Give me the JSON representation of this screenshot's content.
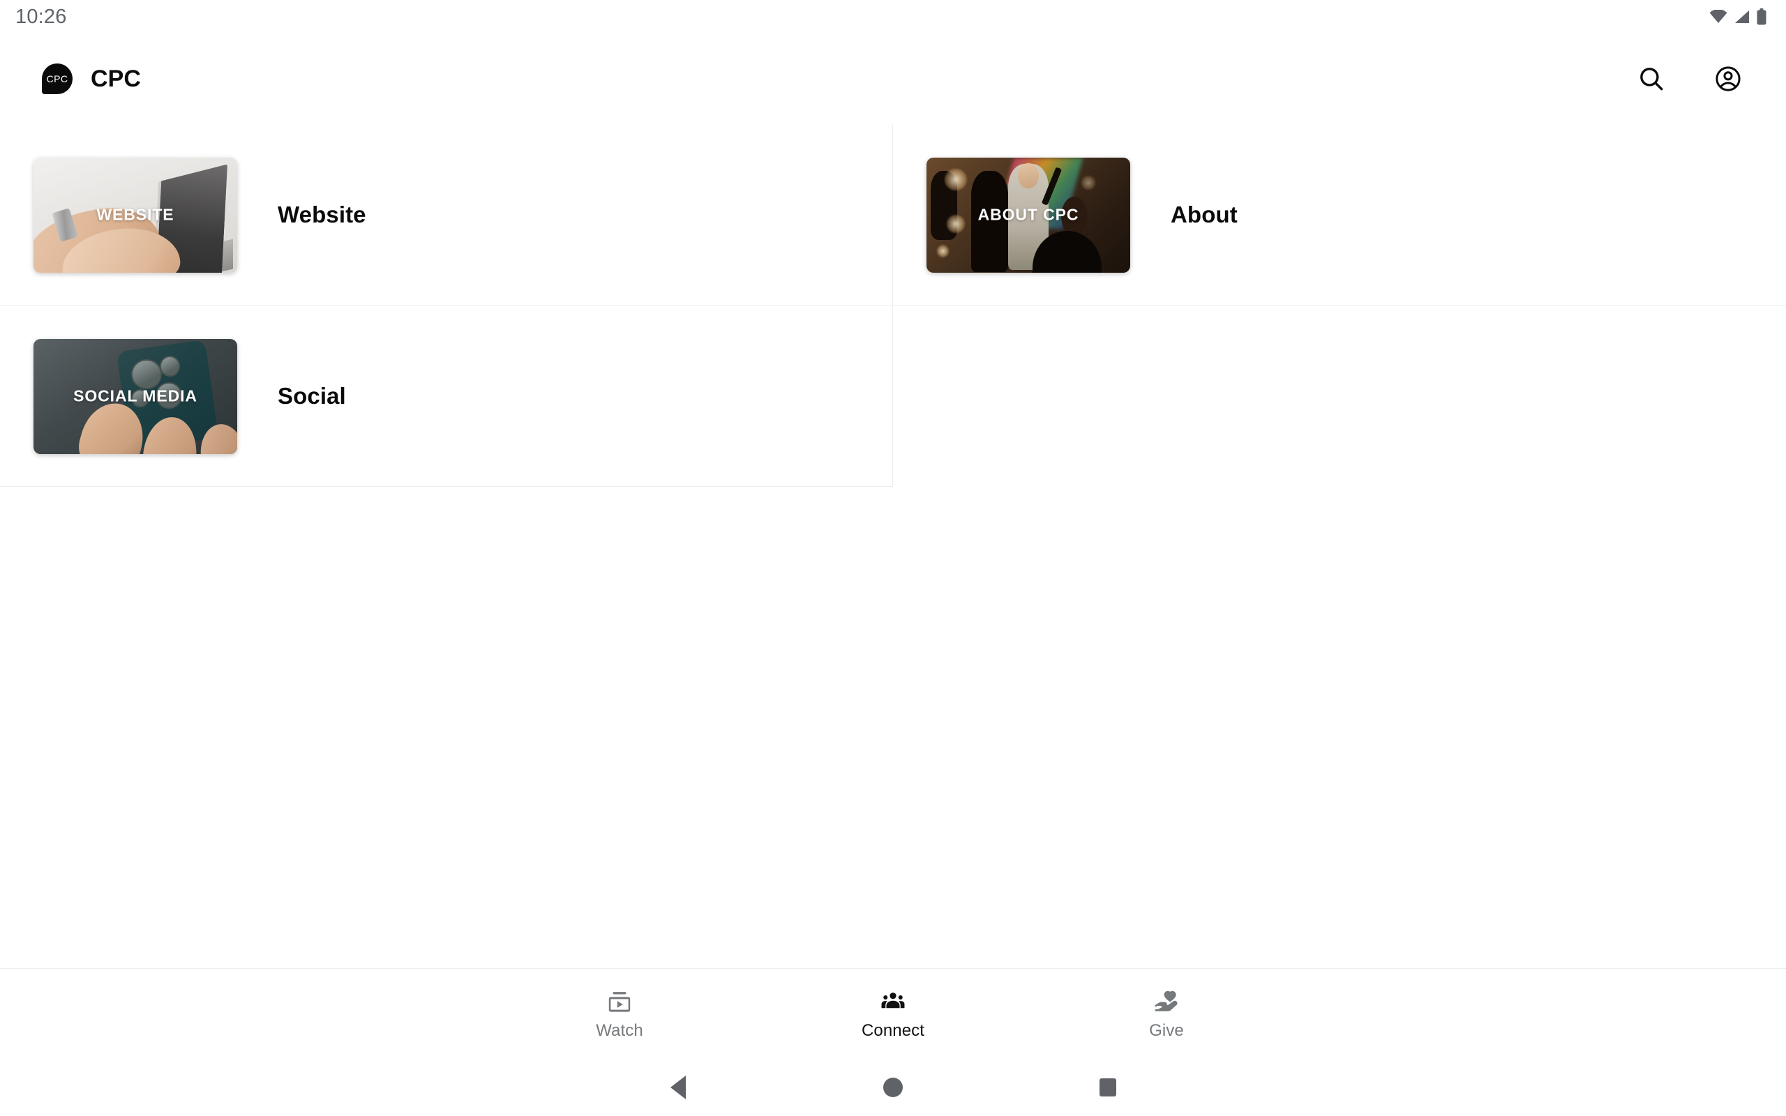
{
  "status_bar": {
    "time": "10:26",
    "icons": [
      "wifi-icon",
      "cellular-signal-icon",
      "battery-icon"
    ]
  },
  "app_bar": {
    "logo_text": "CPC",
    "title": "CPC",
    "actions": [
      {
        "name": "search-icon",
        "label": "Search"
      },
      {
        "name": "account-icon",
        "label": "Account"
      }
    ]
  },
  "main": {
    "items": [
      {
        "title": "Website",
        "thumb_label": "WEBSITE",
        "art": "website"
      },
      {
        "title": "About",
        "thumb_label": "ABOUT CPC",
        "art": "about"
      },
      {
        "title": "Social",
        "thumb_label": "SOCIAL MEDIA",
        "art": "social"
      }
    ]
  },
  "bottom_nav": {
    "items": [
      {
        "label": "Watch",
        "icon": "subscriptions-icon",
        "active": false
      },
      {
        "label": "Connect",
        "icon": "groups-icon",
        "active": true
      },
      {
        "label": "Give",
        "icon": "volunteer-heart-hand-icon",
        "active": false
      }
    ],
    "active_color": "#111111",
    "inactive_color": "#76797c"
  },
  "system_nav": {
    "buttons": [
      "back-button",
      "home-button",
      "recents-button"
    ]
  },
  "colors": {
    "background": "#ffffff",
    "divider": "#ececec",
    "text_primary": "#0b0b0b",
    "text_muted": "#5f6368"
  }
}
